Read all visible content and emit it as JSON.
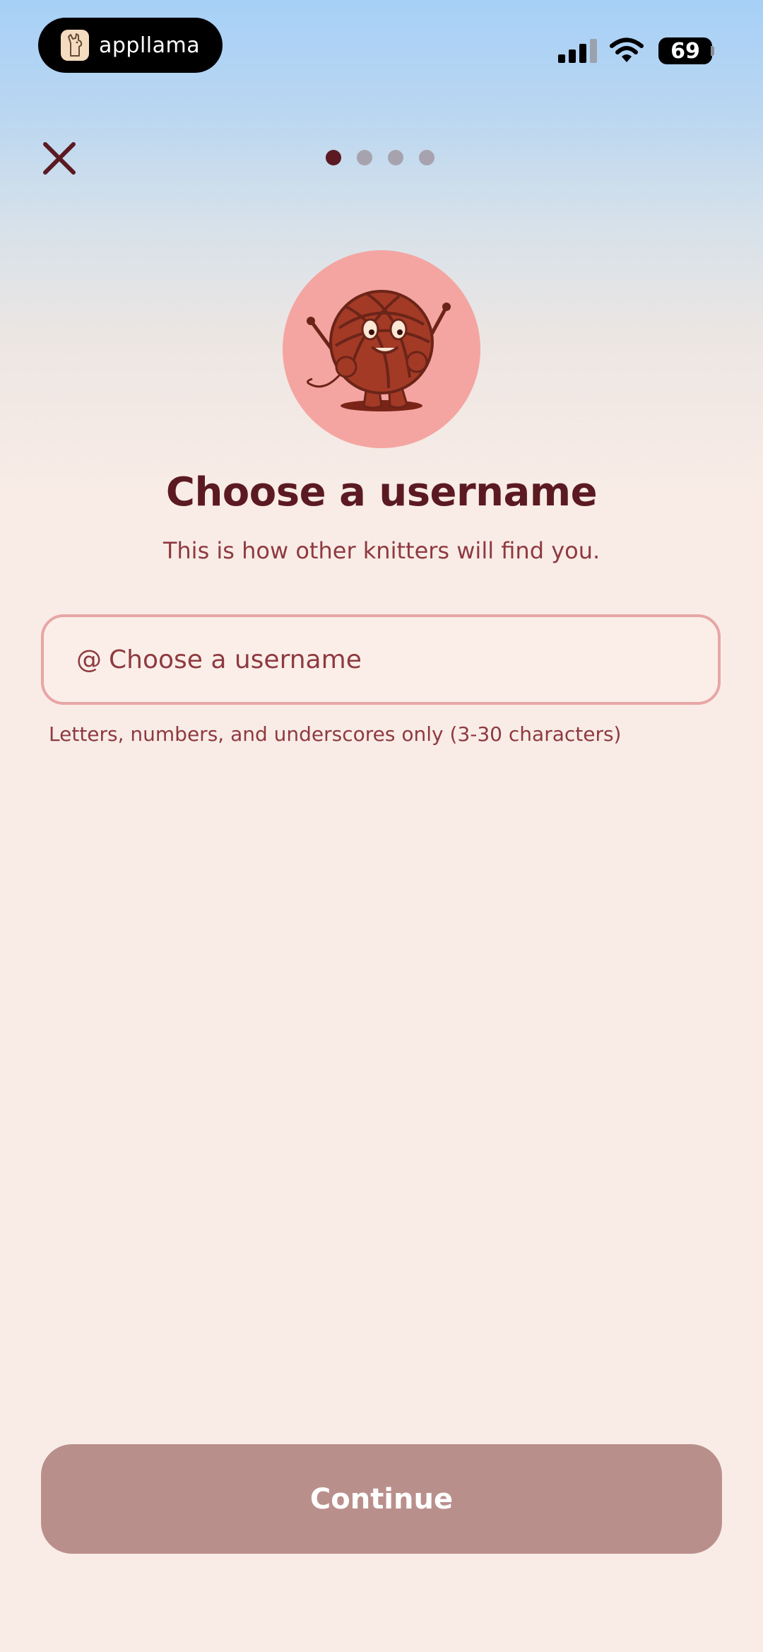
{
  "status_bar": {
    "app_pill_label": "appllama",
    "battery": "69",
    "icons": [
      "llama-logo-icon",
      "cellular-signal-icon",
      "wifi-icon",
      "battery-icon"
    ]
  },
  "header": {
    "close_icon": "close-icon",
    "progress": {
      "total_steps": 4,
      "current_step": 1
    }
  },
  "hero": {
    "mascot": "yarn-ball-mascot",
    "title": "Choose a username",
    "subtitle": "This is how other knitters will find you."
  },
  "username": {
    "prefix": "@",
    "placeholder": "Choose a username",
    "value": "",
    "hint": "Letters, numbers, and underscores only (3-30 characters)"
  },
  "footer": {
    "continue_label": "Continue",
    "continue_enabled": false
  },
  "colors": {
    "brand_dark": "#5b1a22",
    "accent_text": "#8e3a40",
    "input_border": "#e7a6a6",
    "button_disabled": "#b98f8c",
    "background": "#f9ece6",
    "mascot_circle": "#f4a5a1"
  }
}
